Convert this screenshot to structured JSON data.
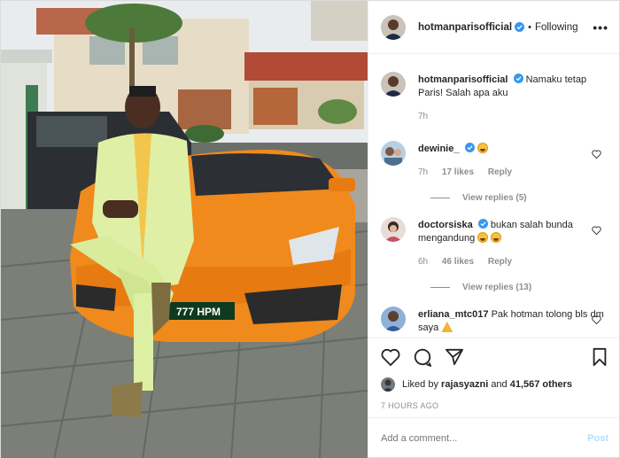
{
  "post": {
    "author": "hotmanparisofficial",
    "follow_status": "Following",
    "more_label": "•••",
    "caption": "Namaku tetap Paris! Salah apa aku",
    "caption_age": "7h"
  },
  "comments": [
    {
      "user": "dewinie_",
      "verified": true,
      "text": "",
      "emoji": "rolling-on-floor-laughing",
      "age": "7h",
      "likes": "17 likes",
      "reply_label": "Reply",
      "view_replies": "View replies (5)"
    },
    {
      "user": "doctorsiska",
      "verified": true,
      "text": "bukan salah bunda mengandung",
      "emoji": "laughing-faces",
      "age": "6h",
      "likes": "46 likes",
      "reply_label": "Reply",
      "view_replies": "View replies (13)"
    },
    {
      "user": "erliana_mtc017",
      "verified": false,
      "text": "Pak hotman tolong bls dm saya",
      "emoji": "folded-hands"
    }
  ],
  "engagement": {
    "liked_prefix": "Liked by",
    "liked_user": "rajasyazni",
    "liked_joiner": "and",
    "liked_others": "41,567 others",
    "timestamp": "7 HOURS AGO"
  },
  "composer": {
    "placeholder": "Add a comment...",
    "post_label": "Post"
  },
  "photo": {
    "plate": "777 HPM",
    "suit_color": "#dff0a6",
    "car_color": "#f08a1c"
  },
  "colors": {
    "verified_blue": "#3897f0",
    "muted": "#8e8e8e",
    "text": "#262626",
    "post_disabled": "#b2dffc"
  }
}
